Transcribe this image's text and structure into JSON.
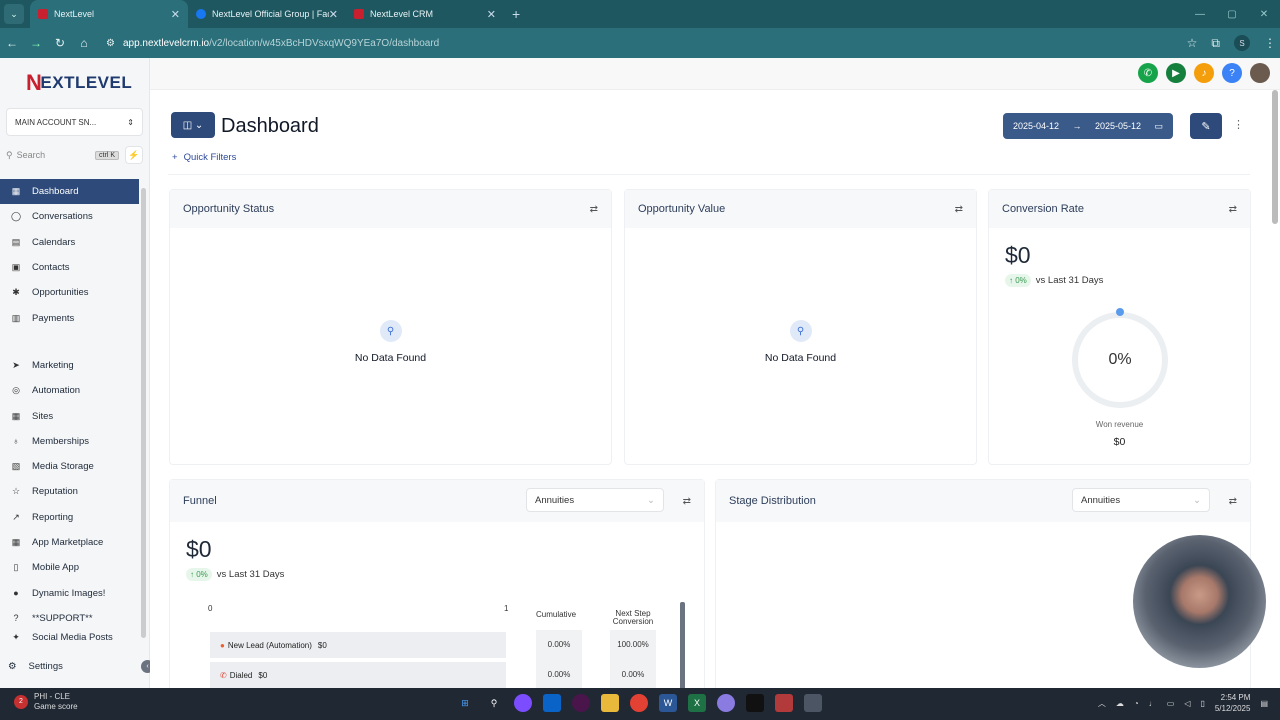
{
  "browser": {
    "tabs": [
      {
        "title": "NextLevel",
        "active": true,
        "fav_color": "#c8202f"
      },
      {
        "title": "NextLevel Official Group | Facel",
        "active": false,
        "fav_color": "#1877f2"
      },
      {
        "title": "NextLevel CRM",
        "active": false,
        "fav_color": "#c8202f"
      }
    ],
    "new_tab": "+",
    "url_host": "app.nextlevelcrm.io",
    "url_path": "/v2/location/w45xBcHDVsxqWQ9YEa7O/dashboard",
    "profile_initial": "S"
  },
  "sidebar": {
    "logo": "EXTLEVEL",
    "logo_n": "N",
    "account": "MAIN ACCOUNT SN...",
    "search_placeholder": "Search",
    "search_kbd": "ctrl K",
    "items_a": [
      {
        "label": "Dashboard",
        "icon": "dashboard-icon",
        "glyph": "▦",
        "active": true
      },
      {
        "label": "Conversations",
        "icon": "chat-icon",
        "glyph": "◯"
      },
      {
        "label": "Calendars",
        "icon": "calendar-icon",
        "glyph": "▤"
      },
      {
        "label": "Contacts",
        "icon": "contacts-icon",
        "glyph": "▣"
      },
      {
        "label": "Opportunities",
        "icon": "opportunities-icon",
        "glyph": "✱"
      },
      {
        "label": "Payments",
        "icon": "payments-icon",
        "glyph": "▥"
      }
    ],
    "items_b": [
      {
        "label": "Marketing",
        "icon": "marketing-icon",
        "glyph": "➤"
      },
      {
        "label": "Automation",
        "icon": "automation-icon",
        "glyph": "◎"
      },
      {
        "label": "Sites",
        "icon": "sites-icon",
        "glyph": "▦"
      },
      {
        "label": "Memberships",
        "icon": "memberships-icon",
        "glyph": "♁"
      },
      {
        "label": "Media Storage",
        "icon": "media-icon",
        "glyph": "▧"
      },
      {
        "label": "Reputation",
        "icon": "star-icon",
        "glyph": "☆"
      },
      {
        "label": "Reporting",
        "icon": "reporting-icon",
        "glyph": "↗"
      },
      {
        "label": "App Marketplace",
        "icon": "marketplace-icon",
        "glyph": "▦"
      },
      {
        "label": "Mobile App",
        "icon": "mobile-icon",
        "glyph": "▯"
      },
      {
        "label": "Dynamic Images!",
        "icon": "globe-icon",
        "glyph": "●"
      },
      {
        "label": "**SUPPORT**",
        "icon": "help-icon",
        "glyph": "?"
      },
      {
        "label": "Social Media Posts",
        "icon": "social-icon",
        "glyph": "✦"
      }
    ],
    "settings": "Settings"
  },
  "header": {
    "title": "Dashboard",
    "quick_filters": "Quick Filters",
    "date_from": "2025-04-12",
    "date_to": "2025-05-12"
  },
  "cards": {
    "opp_status": {
      "title": "Opportunity Status",
      "empty": "No Data Found"
    },
    "opp_value": {
      "title": "Opportunity Value",
      "empty": "No Data Found"
    },
    "conversion": {
      "title": "Conversion Rate",
      "amount": "$0",
      "delta": "↑ 0%",
      "compare": "vs Last 31 Days",
      "ring_pct": "0%",
      "won_label": "Won revenue",
      "won_value": "$0"
    },
    "funnel": {
      "title": "Funnel",
      "select": "Annuities",
      "amount": "$0",
      "delta": "↑ 0%",
      "compare": "vs Last 31 Days",
      "axis_min": "0",
      "axis_max": "1",
      "col_cumulative": "Cumulative",
      "col_next": "Next Step Conversion",
      "rows": [
        {
          "label": "New Lead (Automation)",
          "value": "$0",
          "cumulative": "0.00%",
          "next": "100.00%"
        },
        {
          "label": "Dialed",
          "value": "$0",
          "cumulative": "0.00%",
          "next": "0.00%"
        }
      ]
    },
    "stage": {
      "title": "Stage Distribution",
      "select": "Annuities"
    }
  },
  "taskbar": {
    "weather_title": "PHI - CLE",
    "weather_sub": "Game score",
    "badge": "2",
    "time": "2:54 PM",
    "date": "5/12/2025"
  },
  "colors": {
    "accent": "#2d4a7a",
    "browser": "#2b6f7a",
    "phone": "#16a34a",
    "megaphone": "#15803d",
    "bell": "#f59e0b",
    "help": "#3b82f6"
  }
}
